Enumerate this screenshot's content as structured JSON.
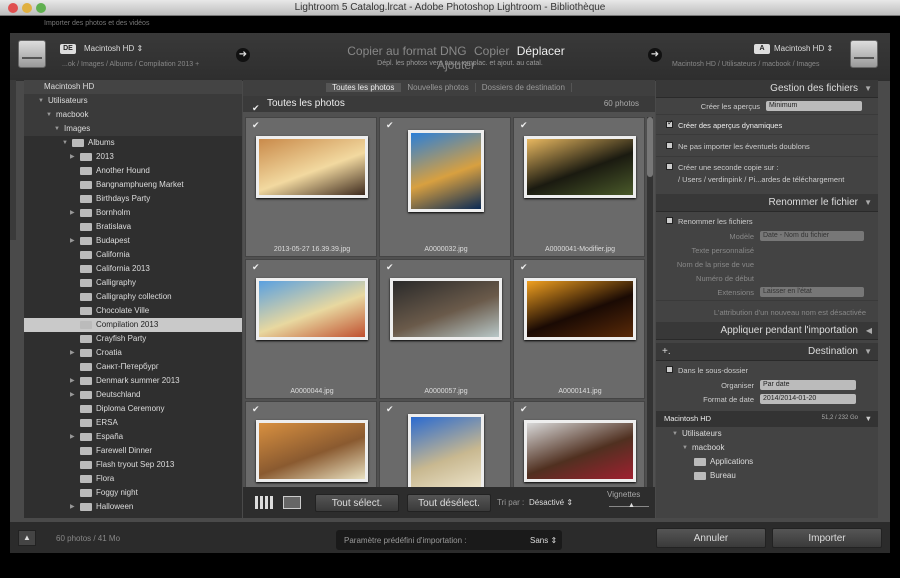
{
  "window": {
    "title": "Lightroom 5 Catalog.lrcat - Adobe Photoshop Lightroom - Bibliothèque",
    "subtitle": "Importer des photos et des vidéos"
  },
  "source": {
    "badge": "DE",
    "name": "Macintosh HD",
    "path": "...ok / Images / Albums / Compilation 2013 +"
  },
  "modes": {
    "items": [
      "Copier au format DNG",
      "Copier",
      "Déplacer",
      "Ajouter"
    ],
    "active": "Déplacer",
    "description": "Dépl. les photos vers nouv. emplac. et ajout. au catal."
  },
  "dest": {
    "badge": "A",
    "name": "Macintosh HD",
    "path": "Macintosh HD / Utilisateurs / macbook / Images"
  },
  "tree": {
    "header": "Macintosh HD",
    "items": [
      {
        "label": "Utilisateurs",
        "level": 1,
        "kind": "node",
        "exp": true
      },
      {
        "label": "macbook",
        "level": 2,
        "kind": "node",
        "exp": true
      },
      {
        "label": "Images",
        "level": 3,
        "kind": "node",
        "exp": true
      },
      {
        "label": "Albums",
        "level": 4,
        "kind": "folder",
        "exp": true
      },
      {
        "label": "2013",
        "level": 5,
        "kind": "folder",
        "exp": false
      },
      {
        "label": "Another Hound",
        "level": 5,
        "kind": "folder"
      },
      {
        "label": "Bangnamphueng Market",
        "level": 5,
        "kind": "folder"
      },
      {
        "label": "Birthdays Party",
        "level": 5,
        "kind": "folder"
      },
      {
        "label": "Bornholm",
        "level": 5,
        "kind": "folder",
        "exp": false
      },
      {
        "label": "Bratislava",
        "level": 5,
        "kind": "folder"
      },
      {
        "label": "Budapest",
        "level": 5,
        "kind": "folder",
        "exp": false
      },
      {
        "label": "California",
        "level": 5,
        "kind": "folder"
      },
      {
        "label": "California 2013",
        "level": 5,
        "kind": "folder"
      },
      {
        "label": "Calligraphy",
        "level": 5,
        "kind": "folder"
      },
      {
        "label": "Calligraphy collection",
        "level": 5,
        "kind": "folder"
      },
      {
        "label": "Chocolate Ville",
        "level": 5,
        "kind": "folder"
      },
      {
        "label": "Compilation 2013",
        "level": 5,
        "kind": "folder",
        "selected": true
      },
      {
        "label": "Crayfish Party",
        "level": 5,
        "kind": "folder"
      },
      {
        "label": "Croatia",
        "level": 5,
        "kind": "folder",
        "exp": false
      },
      {
        "label": "Санкт-Петербург",
        "level": 5,
        "kind": "folder"
      },
      {
        "label": "Denmark summer 2013",
        "level": 5,
        "kind": "folder",
        "exp": false
      },
      {
        "label": "Deutschland",
        "level": 5,
        "kind": "folder",
        "exp": false
      },
      {
        "label": "Diploma Ceremony",
        "level": 5,
        "kind": "folder"
      },
      {
        "label": "ERSA",
        "level": 5,
        "kind": "folder"
      },
      {
        "label": "España",
        "level": 5,
        "kind": "folder",
        "exp": false
      },
      {
        "label": "Farewell Dinner",
        "level": 5,
        "kind": "folder"
      },
      {
        "label": "Flash tryout Sep 2013",
        "level": 5,
        "kind": "folder"
      },
      {
        "label": "Flora",
        "level": 5,
        "kind": "folder"
      },
      {
        "label": "Foggy night",
        "level": 5,
        "kind": "folder"
      },
      {
        "label": "Halloween",
        "level": 5,
        "kind": "folder",
        "exp": false
      }
    ]
  },
  "center": {
    "tabs": [
      "Toutes les photos",
      "Nouvelles photos",
      "Dossiers de destination"
    ],
    "all_label": "Toutes les photos",
    "count": "60 photos",
    "photos": [
      {
        "name": "2013-05-27 16.39.39.jpg",
        "colors": [
          "#c98a4a",
          "#3d2a1e",
          "#f2d9a0"
        ]
      },
      {
        "name": "A0000032.jpg",
        "colors": [
          "#2b7fd8",
          "#0a2a55",
          "#d8a040"
        ],
        "tall": true
      },
      {
        "name": "A0000041-Modifier.jpg",
        "colors": [
          "#e8b860",
          "#4a5a2a",
          "#1a1a10"
        ]
      },
      {
        "name": "A0000044.jpg",
        "colors": [
          "#5aa0e0",
          "#c05030",
          "#e8d8a0"
        ]
      },
      {
        "name": "A0000057.jpg",
        "colors": [
          "#2a2a2a",
          "#b8c8c8",
          "#6a5a4a"
        ]
      },
      {
        "name": "A0000141.jpg",
        "colors": [
          "#f0a020",
          "#5a2a08",
          "#1a0a04"
        ]
      },
      {
        "name": "",
        "colors": [
          "#d89040",
          "#e8e0c0",
          "#8a5a30"
        ]
      },
      {
        "name": "",
        "colors": [
          "#2a6ad0",
          "#f0e8d0",
          "#c8b890"
        ],
        "tall": true
      },
      {
        "name": "",
        "colors": [
          "#d8d8d8",
          "#a02030",
          "#503020"
        ]
      }
    ],
    "buttons": {
      "select_all": "Tout sélect.",
      "deselect_all": "Tout désélect."
    },
    "sort_label": "Tri par :",
    "sort_value": "Désactivé",
    "thumb_label": "Vignettes"
  },
  "right": {
    "file_handling": {
      "title": "Gestion des fichiers",
      "previews_label": "Créer les aperçus",
      "previews_value": "Minimum",
      "smart_previews": "Créer des aperçus dynamiques",
      "no_duplicates": "Ne pas importer les éventuels doublons",
      "second_copy": "Créer une seconde copie sur :",
      "second_copy_path": "/ Users / verdinpink / Pi...ardes de téléchargement"
    },
    "rename": {
      "title": "Renommer le fichier",
      "rename_label": "Renommer les fichiers",
      "model_label": "Modèle",
      "model_value": "Date - Nom du fichier",
      "custom_text": "Texte personnalisé",
      "shoot_name": "Nom de la prise de vue",
      "start_number": "Numéro de début",
      "extensions_label": "Extensions",
      "extensions_value": "Laisser en l'état",
      "note": "L'attribution d'un nouveau nom est désactivée"
    },
    "apply": {
      "title": "Appliquer pendant l'importation"
    },
    "destination": {
      "title": "Destination",
      "subfolder": "Dans le sous-dossier",
      "organize_label": "Organiser",
      "organize_value": "Par date",
      "date_format_label": "Format de date",
      "date_format_value": "2014/2014-01-20",
      "disk_name": "Macintosh HD",
      "disk_space": "51,2 / 232 Go",
      "tree": [
        {
          "label": "Utilisateurs",
          "level": 1
        },
        {
          "label": "macbook",
          "level": 2
        },
        {
          "label": "Applications",
          "level": 3
        },
        {
          "label": "Bureau",
          "level": 3
        }
      ]
    }
  },
  "footer": {
    "status": "60 photos / 41 Mo",
    "preset_label": "Paramètre prédéfini d'importation :",
    "preset_value": "Sans",
    "cancel": "Annuler",
    "import": "Importer"
  }
}
